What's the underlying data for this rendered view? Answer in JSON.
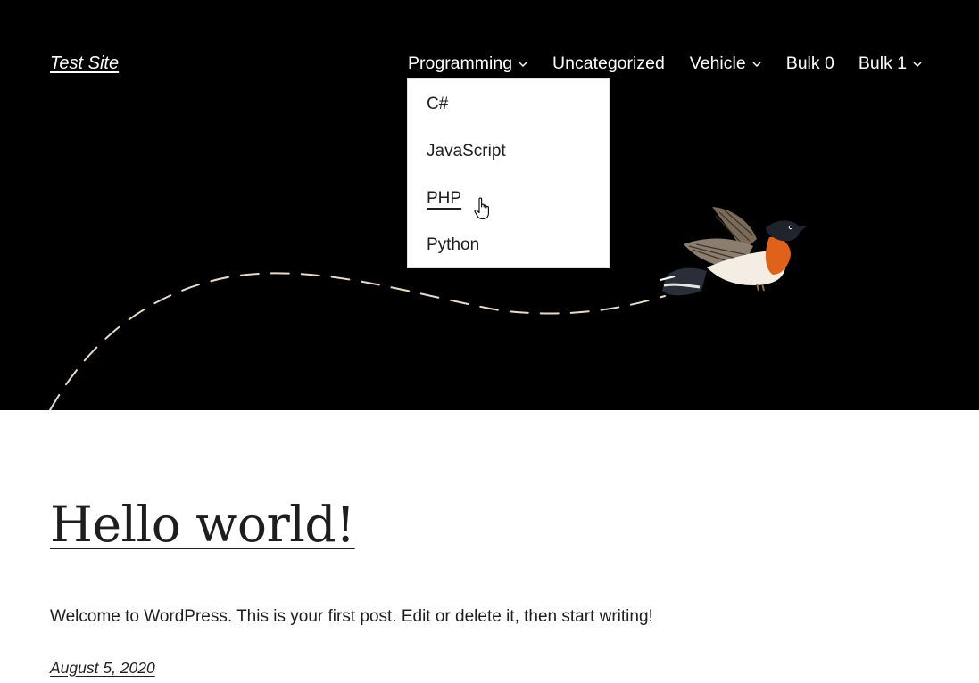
{
  "site": {
    "title": "Test Site"
  },
  "nav": {
    "items": [
      {
        "label": "Programming",
        "has_submenu": true
      },
      {
        "label": "Uncategorized",
        "has_submenu": false
      },
      {
        "label": "Vehicle",
        "has_submenu": true
      },
      {
        "label": "Bulk 0",
        "has_submenu": false
      },
      {
        "label": "Bulk 1",
        "has_submenu": true
      }
    ],
    "open_submenu": {
      "parent": "Programming",
      "items": [
        {
          "label": "C#"
        },
        {
          "label": "JavaScript"
        },
        {
          "label": "PHP",
          "hovered": true
        },
        {
          "label": "Python"
        }
      ]
    }
  },
  "header_art": {
    "bird_icon": "bird-illustration",
    "path": "dashed-flight-path",
    "path_color": "#e8dcc8",
    "background": "#000000"
  },
  "post": {
    "title": "Hello world!",
    "excerpt": "Welcome to WordPress. This is your first post. Edit or delete it, then start writing!",
    "date": "August 5, 2020"
  },
  "cursor": {
    "type": "hand-pointer-icon"
  }
}
